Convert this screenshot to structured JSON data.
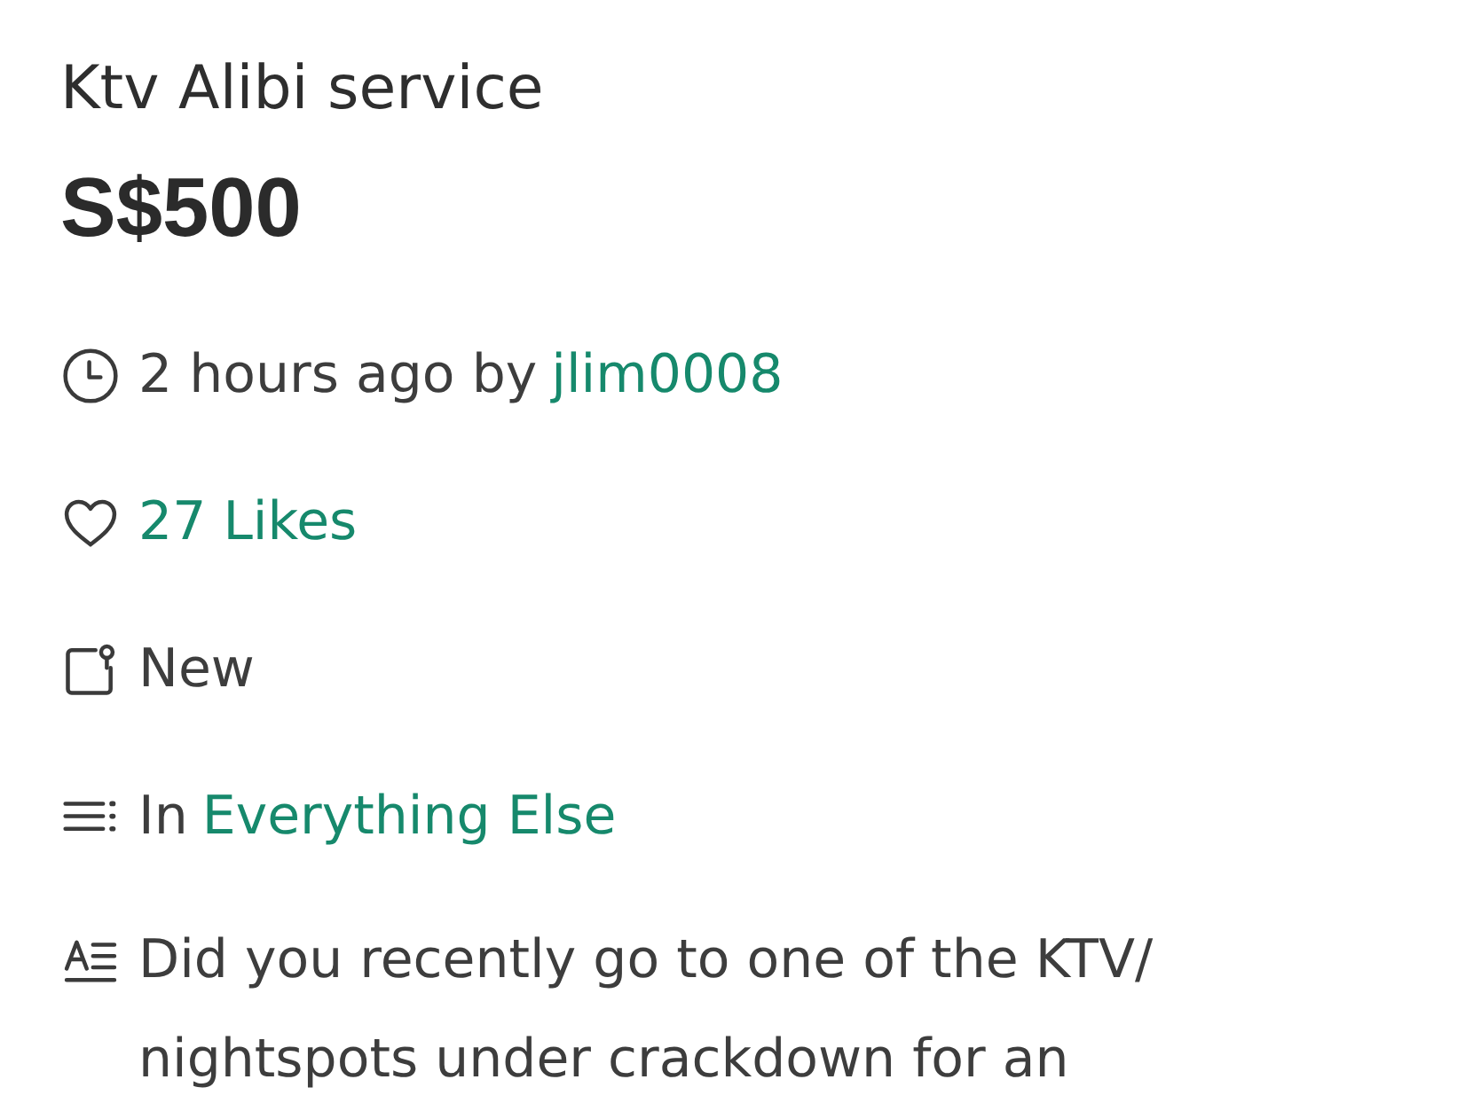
{
  "listing": {
    "title": "Ktv Alibi service",
    "price": "S$500"
  },
  "details": [
    {
      "kind": "posted",
      "text": "2 hours ago by",
      "link": "jlim0008"
    },
    {
      "kind": "likes",
      "link": "27 Likes"
    },
    {
      "kind": "condition",
      "text": "New"
    },
    {
      "kind": "category",
      "text": "In",
      "link": "Everything Else"
    },
    {
      "kind": "description",
      "text": "Did you recently go to one of the KTV/ nightspots under crackdown for an"
    }
  ]
}
